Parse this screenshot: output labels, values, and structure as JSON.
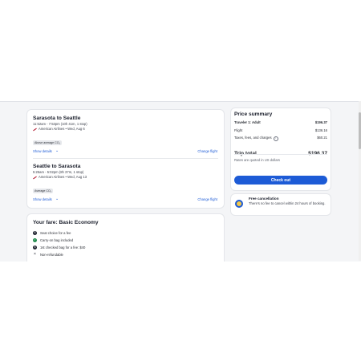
{
  "flights": [
    {
      "title": "Sarasota to Seattle",
      "times": "11:52am - 7:53pm (10h 41m, 1 stop)",
      "airline": "American Airlines • Wed, Aug 6",
      "badge": "Above average CO₂",
      "show_details": "Show details",
      "change_flight": "Change flight"
    },
    {
      "title": "Seattle to Sarasota",
      "times": "5:25am - 5:02pm (8h 37m, 1 stop)",
      "airline": "American Airlines • Wed, Aug 13",
      "badge": "Average CO₂",
      "show_details": "Show details",
      "change_flight": "Change flight"
    }
  ],
  "fare": {
    "title": "Your fare: Basic Economy",
    "items": [
      {
        "label": "Seat choice for a fee",
        "icon": "dollar-icon"
      },
      {
        "label": "Carry-on bag included",
        "icon": "check-icon"
      },
      {
        "label": "1st checked bag for a fee: $40",
        "icon": "dollar-icon"
      },
      {
        "label": "Non-refundable",
        "icon": "x-icon"
      }
    ]
  },
  "price_summary": {
    "title": "Price summary",
    "traveler_label": "Traveler 1: Adult",
    "traveler_value": "$196.37",
    "flight_label": "Flight",
    "flight_value": "$136.16",
    "taxes_label": "Taxes, fees, and charges",
    "taxes_value": "$60.21",
    "total_label": "Trip total",
    "total_value": "$196.37",
    "currency_note": "Rates are quoted in US dollars",
    "checkout": "Check out"
  },
  "cancellation": {
    "title": "Free cancellation",
    "text": "There's no fee to cancel within 24 hours of booking."
  },
  "colors": {
    "accent": "#1d5bd6",
    "success": "#1f8b4c",
    "airline": "#b2162e"
  }
}
